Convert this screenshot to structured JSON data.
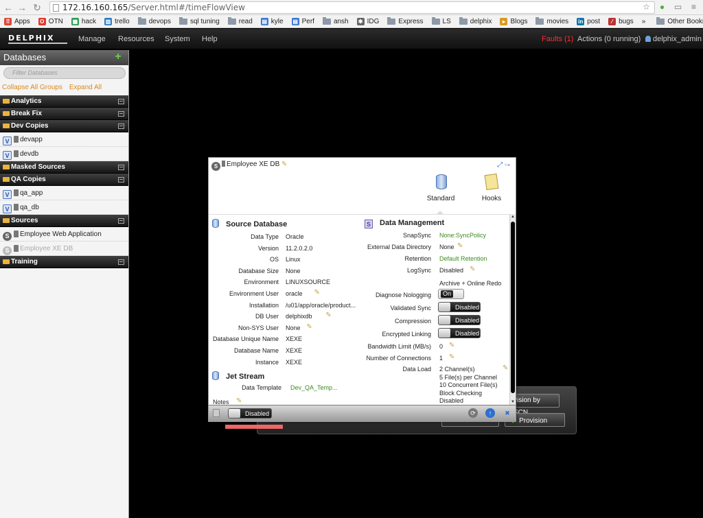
{
  "browser": {
    "url_host": "172.16.160.165",
    "url_path": "/Server.html#/timeFlowView",
    "bookmarks": [
      {
        "label": "Apps",
        "kind": "apps"
      },
      {
        "label": "OTN",
        "kind": "otn"
      },
      {
        "label": "hack",
        "kind": "sheet"
      },
      {
        "label": "trello",
        "kind": "trello"
      },
      {
        "label": "devops",
        "kind": "folder"
      },
      {
        "label": "sql tuning",
        "kind": "folder"
      },
      {
        "label": "read",
        "kind": "folder"
      },
      {
        "label": "kyle",
        "kind": "doc"
      },
      {
        "label": "Perf",
        "kind": "doc"
      },
      {
        "label": "ansh",
        "kind": "folder"
      },
      {
        "label": "IDG",
        "kind": "idg"
      },
      {
        "label": "Express",
        "kind": "folder"
      },
      {
        "label": "LS",
        "kind": "folder"
      },
      {
        "label": "delphix",
        "kind": "folder"
      },
      {
        "label": "Blogs",
        "kind": "blogs"
      },
      {
        "label": "movies",
        "kind": "folder"
      },
      {
        "label": "post",
        "kind": "linkedin"
      },
      {
        "label": "bugs",
        "kind": "bugs"
      }
    ],
    "more": "»",
    "other_bookmarks": "Other Bookmarks"
  },
  "app": {
    "logo": "DELPHIX",
    "menu": [
      "Manage",
      "Resources",
      "System",
      "Help"
    ],
    "faults": "Faults (1)",
    "actions": "Actions (0 running)",
    "user": "delphix_admin"
  },
  "sidebar": {
    "title": "Databases",
    "filter_placeholder": "Filter Databases",
    "collapse_all": "Collapse All Groups",
    "expand_all": "Expand All Groups",
    "rows": [
      {
        "type": "group",
        "label": "Analytics"
      },
      {
        "type": "group",
        "label": "Break Fix"
      },
      {
        "type": "group",
        "label": "Dev Copies"
      },
      {
        "type": "item",
        "icon": "vdb-icon",
        "label": "devapp",
        "dim": false
      },
      {
        "type": "item",
        "icon": "vdb-icon",
        "label": "devdb",
        "dim": false
      },
      {
        "type": "group",
        "label": "Masked Sources"
      },
      {
        "type": "group",
        "label": "QA Copies"
      },
      {
        "type": "item",
        "icon": "vdb-icon",
        "label": "qa_app",
        "dim": false
      },
      {
        "type": "item",
        "icon": "vdb-icon",
        "label": "qa_db",
        "dim": false
      },
      {
        "type": "group",
        "label": "Sources"
      },
      {
        "type": "item",
        "icon": "source-icon",
        "label": "Employee Web Application",
        "dim": false
      },
      {
        "type": "item",
        "icon": "source-icon",
        "label": "Employee XE DB",
        "dim": true
      },
      {
        "type": "group",
        "label": "Training"
      }
    ]
  },
  "card": {
    "title": "Employee XE DB",
    "tabs": [
      {
        "label": "Standard",
        "icon": "database-icon"
      },
      {
        "label": "Hooks",
        "icon": "scroll-icon"
      }
    ],
    "source": {
      "heading": "Source Database",
      "rows": [
        {
          "label": "Data Type",
          "value": "Oracle",
          "edit": false
        },
        {
          "label": "Version",
          "value": "11.2.0.2.0",
          "edit": false
        },
        {
          "label": "OS",
          "value": "Linux",
          "edit": false
        },
        {
          "label": "Database Size",
          "value": "None",
          "edit": false
        },
        {
          "label": "Environment",
          "value": "LINUXSOURCE",
          "edit": false
        },
        {
          "label": "Environment User",
          "value": "oracle",
          "edit": true
        },
        {
          "label": "Installation",
          "value": "/u01/app/oracle/product...",
          "edit": false
        },
        {
          "label": "DB User",
          "value": "delphixdb",
          "edit": true
        },
        {
          "label": "Non-SYS User",
          "value": "None",
          "edit": true
        },
        {
          "label": "Database Unique Name",
          "value": "XEXE",
          "edit": false
        },
        {
          "label": "Database Name",
          "value": "XEXE",
          "edit": false
        },
        {
          "label": "Instance",
          "value": "XEXE",
          "edit": false
        }
      ]
    },
    "jetstream": {
      "heading": "Jet Stream",
      "label": "Data Template",
      "value": "Dev_QA_Temp..."
    },
    "notes_label": "Notes",
    "management": {
      "heading": "Data Management",
      "snapsync_label": "SnapSync",
      "snapsync_value": "None:SyncPolicy",
      "ext_dir_label": "External Data Directory",
      "ext_dir_value": "None",
      "retention_label": "Retention",
      "retention_value": "Default Retention",
      "logsync_label": "LogSync",
      "logsync_value": "Disabled",
      "logsync_mode": "Archive + Online Redo",
      "nologging_label": "Diagnose Nologging",
      "nologging_value": "On",
      "validated_label": "Validated Sync",
      "validated_value": "Disabled",
      "compression_label": "Compression",
      "compression_value": "Disabled",
      "encrypted_label": "Encrypted Linking",
      "encrypted_value": "Disabled",
      "bandwidth_label": "Bandwidth Limit (MB/s)",
      "bandwidth_value": "0",
      "connections_label": "Number of Connections",
      "connections_value": "1",
      "dataload_label": "Data Load",
      "dataload_lines": [
        "2 Channel(s)",
        "5 File(s) per Channel",
        "10 Concurrent File(s)",
        "Block Checking",
        "Disabled"
      ]
    },
    "footer_toggle": "Disabled"
  },
  "timeflow": {
    "scn_button": "vision by SCN",
    "provision_button": "Provision"
  }
}
